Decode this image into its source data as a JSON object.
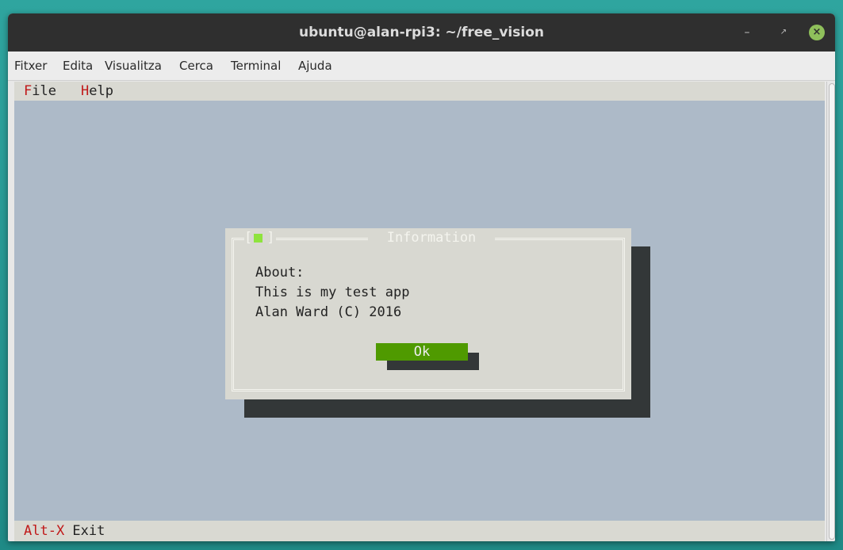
{
  "window": {
    "title": "ubuntu@alan-rpi3: ~/free_vision",
    "minimize_glyph": "–",
    "maximize_glyph": "↗",
    "close_glyph": "×"
  },
  "menubar": {
    "items": [
      "Fitxer",
      "Edita",
      "Visualitza",
      "Cerca",
      "Terminal",
      "Ajuda"
    ]
  },
  "app_menu": {
    "file": {
      "hot": "F",
      "rest": "ile"
    },
    "help": {
      "hot": "H",
      "rest": "elp"
    }
  },
  "dialog": {
    "title": "Information",
    "close_left": "[",
    "close_right": "]",
    "lines": [
      "About:",
      "This is my test app",
      "Alan Ward (C) 2016"
    ],
    "ok_label": "Ok"
  },
  "status": {
    "key": "Alt-X",
    "label": " Exit"
  },
  "colors": {
    "desktop": "#2f9b97",
    "titlebar": "#2f2f2f",
    "terminal_bg": "#adbac8",
    "hotkey": "#c01818",
    "ok_button": "#4f9a00",
    "close_square": "#8ee33d"
  }
}
